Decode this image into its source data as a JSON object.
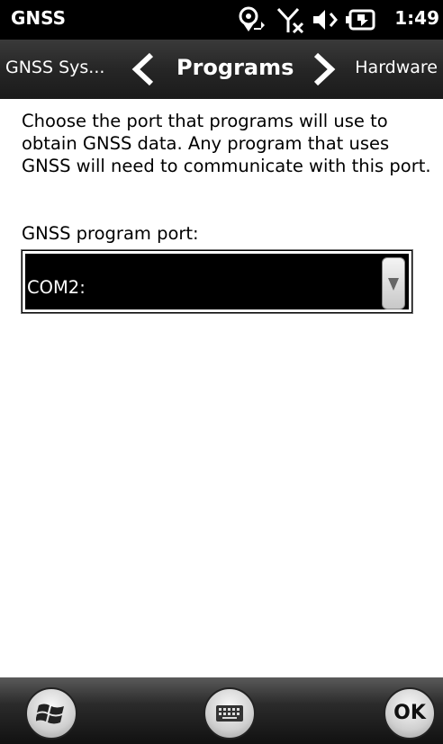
{
  "status_bar": {
    "app_title": "GNSS",
    "time": "1:49",
    "icons": [
      "gps-satellite-icon",
      "no-signal-icon",
      "volume-icon",
      "battery-charging-icon"
    ]
  },
  "tab_nav": {
    "previous": "GNSS Sys...",
    "current": "Programs",
    "next": "Hardware"
  },
  "content": {
    "description": "Choose the port that programs will use to obtain GNSS data.  Any program that uses GNSS will need to communicate with this port.",
    "port_label": "GNSS program port:",
    "port_value": "COM2:"
  },
  "bottom_bar": {
    "left_icon": "windows-start-icon",
    "center_icon": "keyboard-icon",
    "ok_label": "OK"
  }
}
